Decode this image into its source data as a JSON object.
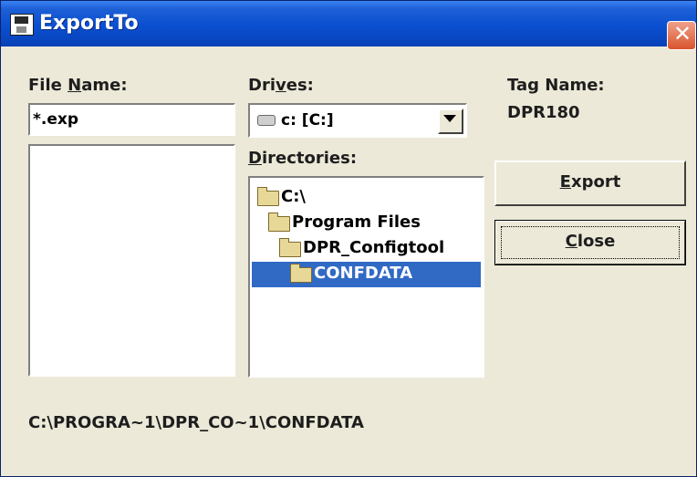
{
  "window": {
    "title": "ExportTo",
    "close_glyph": "✕"
  },
  "file_name": {
    "label_pre": "File ",
    "label_accel": "N",
    "label_post": "ame:",
    "value": "*.exp"
  },
  "drives": {
    "label_pre": "Dri",
    "label_accel": "v",
    "label_post": "es:",
    "selected": "c: [C:]"
  },
  "directories": {
    "label_accel": "D",
    "label_post": "irectories:",
    "items": [
      {
        "name": "C:\\",
        "selected": false
      },
      {
        "name": "Program Files",
        "selected": false
      },
      {
        "name": "DPR_Configtool",
        "selected": false
      },
      {
        "name": "CONFDATA",
        "selected": true
      }
    ]
  },
  "tag": {
    "label": "Tag Name:",
    "value": "DPR180"
  },
  "buttons": {
    "export_accel": "E",
    "export_rest": "xport",
    "close_accel": "C",
    "close_rest": "lose"
  },
  "current_path": "C:\\PROGRA~1\\DPR_CO~1\\CONFDATA",
  "colors": {
    "titlebar": "#0a4fd0",
    "selection": "#316ac5",
    "face": "#ece9d8"
  }
}
